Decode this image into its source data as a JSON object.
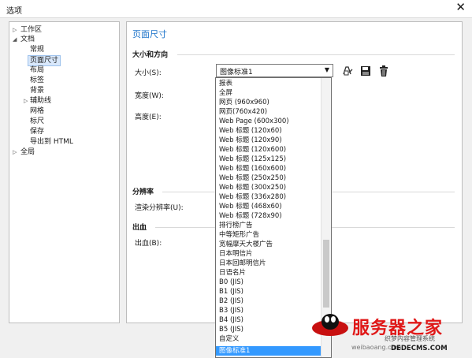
{
  "window": {
    "title": "选项",
    "close_glyph": "✕"
  },
  "tree": [
    {
      "label": "工作区",
      "expander": "▷"
    },
    {
      "label": "文档",
      "expander": "◢"
    },
    {
      "label": "常规"
    },
    {
      "label": "页面尺寸"
    },
    {
      "label": "布局"
    },
    {
      "label": "标签"
    },
    {
      "label": "背景"
    },
    {
      "label": "辅助线",
      "expander": "▷"
    },
    {
      "label": "网格"
    },
    {
      "label": "标尺"
    },
    {
      "label": "保存"
    },
    {
      "label": "导出到 HTML"
    },
    {
      "label": "全局",
      "expander": "▷"
    }
  ],
  "panel": {
    "title": "页面尺寸",
    "section_size": "大小和方向",
    "size_label": "大小(S):",
    "width_label": "宽度(W):",
    "height_label": "高度(E):",
    "section_resolution": "分辨率",
    "render_label": "渲染分辨率(U):",
    "section_bleed": "出血",
    "bleed_label": "出血(B):"
  },
  "size_combo": {
    "value": "图像标准1",
    "arrow": "▼"
  },
  "toolbar_icons": [
    "save-preset-icon",
    "save-disk-icon",
    "trash-icon"
  ],
  "dropdown_options": [
    "报表",
    "全屏",
    "网页 (960x960)",
    "网页(760x420)",
    "Web Page (600x300)",
    "Web 标题 (120x60)",
    "Web 标题 (120x90)",
    "Web 标题 (120x600)",
    "Web 标题 (125x125)",
    "Web 标题 (160x600)",
    "Web 标题 (250x250)",
    "Web 标题 (300x250)",
    "Web 标题 (336x280)",
    "Web 标题 (468x60)",
    "Web 标题 (728x90)",
    "排行榜广告",
    "中等矩形广告",
    "宽幅摩天大楼广告",
    "日本明信片",
    "日本回邮明信片",
    "日语名片",
    "B0 (JIS)",
    "B1 (JIS)",
    "B2 (JIS)",
    "B3 (JIS)",
    "B4 (JIS)",
    "B5 (JIS)",
    "自定义",
    "图像标准1"
  ],
  "watermark": {
    "name": "服务器之家",
    "subtitle": "织梦内容管理系统",
    "site": "DEDECMS.COM",
    "url": "weibaoang.com",
    "brand_color": "#e01818"
  }
}
